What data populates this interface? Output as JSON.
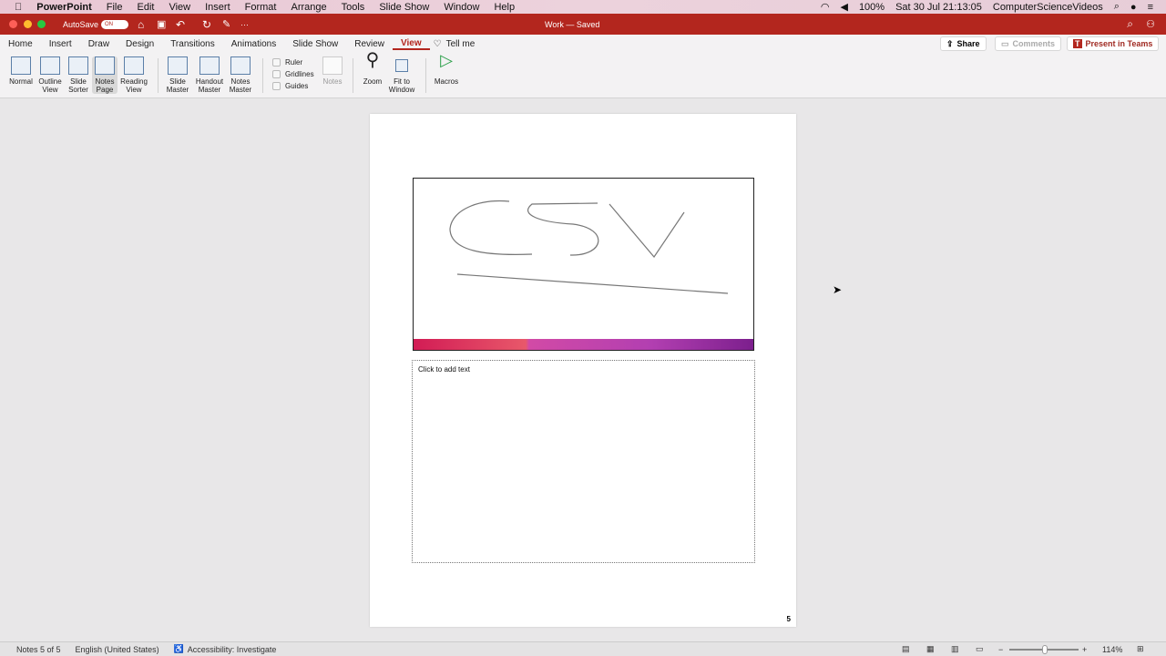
{
  "menubar": {
    "app": "PowerPoint",
    "items": [
      "File",
      "Edit",
      "View",
      "Insert",
      "Format",
      "Arrange",
      "Tools",
      "Slide Show",
      "Window",
      "Help"
    ],
    "battery": "100%",
    "datetime": "Sat 30 Jul  21:13:05",
    "user": "ComputerScienceVideos"
  },
  "titlebar": {
    "autosave": "AutoSave",
    "autosave_state": "ON",
    "doc_title": "Work — Saved"
  },
  "tabs": [
    "Home",
    "Insert",
    "Draw",
    "Design",
    "Transitions",
    "Animations",
    "Slide Show",
    "Review",
    "View"
  ],
  "tell_me": "Tell me",
  "ribbon": {
    "views": [
      "Normal",
      "Outline View",
      "Slide Sorter",
      "Notes Page",
      "Reading View"
    ],
    "masters": [
      "Slide Master",
      "Handout Master",
      "Notes Master"
    ],
    "checkboxes": [
      "Ruler",
      "Gridlines",
      "Guides"
    ],
    "notes": "Notes",
    "zoom": "Zoom",
    "fit": "Fit to Window",
    "macros": "Macros"
  },
  "actions": {
    "share": "Share",
    "comments": "Comments",
    "present": "Present in Teams"
  },
  "slide": {
    "handwriting": "CSV",
    "notes_placeholder": "Click to add text",
    "page_number": "5"
  },
  "status": {
    "notes": "Notes 5 of 5",
    "language": "English (United States)",
    "accessibility": "Accessibility: Investigate",
    "zoom": "114%"
  }
}
